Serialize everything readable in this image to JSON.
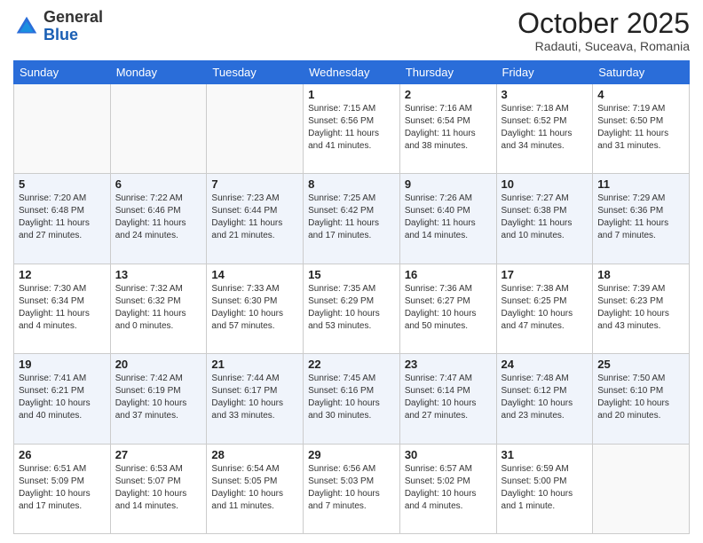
{
  "header": {
    "logo_general": "General",
    "logo_blue": "Blue",
    "month_title": "October 2025",
    "location": "Radauti, Suceava, Romania"
  },
  "days_of_week": [
    "Sunday",
    "Monday",
    "Tuesday",
    "Wednesday",
    "Thursday",
    "Friday",
    "Saturday"
  ],
  "weeks": [
    [
      {
        "day": "",
        "info": ""
      },
      {
        "day": "",
        "info": ""
      },
      {
        "day": "",
        "info": ""
      },
      {
        "day": "1",
        "info": "Sunrise: 7:15 AM\nSunset: 6:56 PM\nDaylight: 11 hours\nand 41 minutes."
      },
      {
        "day": "2",
        "info": "Sunrise: 7:16 AM\nSunset: 6:54 PM\nDaylight: 11 hours\nand 38 minutes."
      },
      {
        "day": "3",
        "info": "Sunrise: 7:18 AM\nSunset: 6:52 PM\nDaylight: 11 hours\nand 34 minutes."
      },
      {
        "day": "4",
        "info": "Sunrise: 7:19 AM\nSunset: 6:50 PM\nDaylight: 11 hours\nand 31 minutes."
      }
    ],
    [
      {
        "day": "5",
        "info": "Sunrise: 7:20 AM\nSunset: 6:48 PM\nDaylight: 11 hours\nand 27 minutes."
      },
      {
        "day": "6",
        "info": "Sunrise: 7:22 AM\nSunset: 6:46 PM\nDaylight: 11 hours\nand 24 minutes."
      },
      {
        "day": "7",
        "info": "Sunrise: 7:23 AM\nSunset: 6:44 PM\nDaylight: 11 hours\nand 21 minutes."
      },
      {
        "day": "8",
        "info": "Sunrise: 7:25 AM\nSunset: 6:42 PM\nDaylight: 11 hours\nand 17 minutes."
      },
      {
        "day": "9",
        "info": "Sunrise: 7:26 AM\nSunset: 6:40 PM\nDaylight: 11 hours\nand 14 minutes."
      },
      {
        "day": "10",
        "info": "Sunrise: 7:27 AM\nSunset: 6:38 PM\nDaylight: 11 hours\nand 10 minutes."
      },
      {
        "day": "11",
        "info": "Sunrise: 7:29 AM\nSunset: 6:36 PM\nDaylight: 11 hours\nand 7 minutes."
      }
    ],
    [
      {
        "day": "12",
        "info": "Sunrise: 7:30 AM\nSunset: 6:34 PM\nDaylight: 11 hours\nand 4 minutes."
      },
      {
        "day": "13",
        "info": "Sunrise: 7:32 AM\nSunset: 6:32 PM\nDaylight: 11 hours\nand 0 minutes."
      },
      {
        "day": "14",
        "info": "Sunrise: 7:33 AM\nSunset: 6:30 PM\nDaylight: 10 hours\nand 57 minutes."
      },
      {
        "day": "15",
        "info": "Sunrise: 7:35 AM\nSunset: 6:29 PM\nDaylight: 10 hours\nand 53 minutes."
      },
      {
        "day": "16",
        "info": "Sunrise: 7:36 AM\nSunset: 6:27 PM\nDaylight: 10 hours\nand 50 minutes."
      },
      {
        "day": "17",
        "info": "Sunrise: 7:38 AM\nSunset: 6:25 PM\nDaylight: 10 hours\nand 47 minutes."
      },
      {
        "day": "18",
        "info": "Sunrise: 7:39 AM\nSunset: 6:23 PM\nDaylight: 10 hours\nand 43 minutes."
      }
    ],
    [
      {
        "day": "19",
        "info": "Sunrise: 7:41 AM\nSunset: 6:21 PM\nDaylight: 10 hours\nand 40 minutes."
      },
      {
        "day": "20",
        "info": "Sunrise: 7:42 AM\nSunset: 6:19 PM\nDaylight: 10 hours\nand 37 minutes."
      },
      {
        "day": "21",
        "info": "Sunrise: 7:44 AM\nSunset: 6:17 PM\nDaylight: 10 hours\nand 33 minutes."
      },
      {
        "day": "22",
        "info": "Sunrise: 7:45 AM\nSunset: 6:16 PM\nDaylight: 10 hours\nand 30 minutes."
      },
      {
        "day": "23",
        "info": "Sunrise: 7:47 AM\nSunset: 6:14 PM\nDaylight: 10 hours\nand 27 minutes."
      },
      {
        "day": "24",
        "info": "Sunrise: 7:48 AM\nSunset: 6:12 PM\nDaylight: 10 hours\nand 23 minutes."
      },
      {
        "day": "25",
        "info": "Sunrise: 7:50 AM\nSunset: 6:10 PM\nDaylight: 10 hours\nand 20 minutes."
      }
    ],
    [
      {
        "day": "26",
        "info": "Sunrise: 6:51 AM\nSunset: 5:09 PM\nDaylight: 10 hours\nand 17 minutes."
      },
      {
        "day": "27",
        "info": "Sunrise: 6:53 AM\nSunset: 5:07 PM\nDaylight: 10 hours\nand 14 minutes."
      },
      {
        "day": "28",
        "info": "Sunrise: 6:54 AM\nSunset: 5:05 PM\nDaylight: 10 hours\nand 11 minutes."
      },
      {
        "day": "29",
        "info": "Sunrise: 6:56 AM\nSunset: 5:03 PM\nDaylight: 10 hours\nand 7 minutes."
      },
      {
        "day": "30",
        "info": "Sunrise: 6:57 AM\nSunset: 5:02 PM\nDaylight: 10 hours\nand 4 minutes."
      },
      {
        "day": "31",
        "info": "Sunrise: 6:59 AM\nSunset: 5:00 PM\nDaylight: 10 hours\nand 1 minute."
      },
      {
        "day": "",
        "info": ""
      }
    ]
  ]
}
